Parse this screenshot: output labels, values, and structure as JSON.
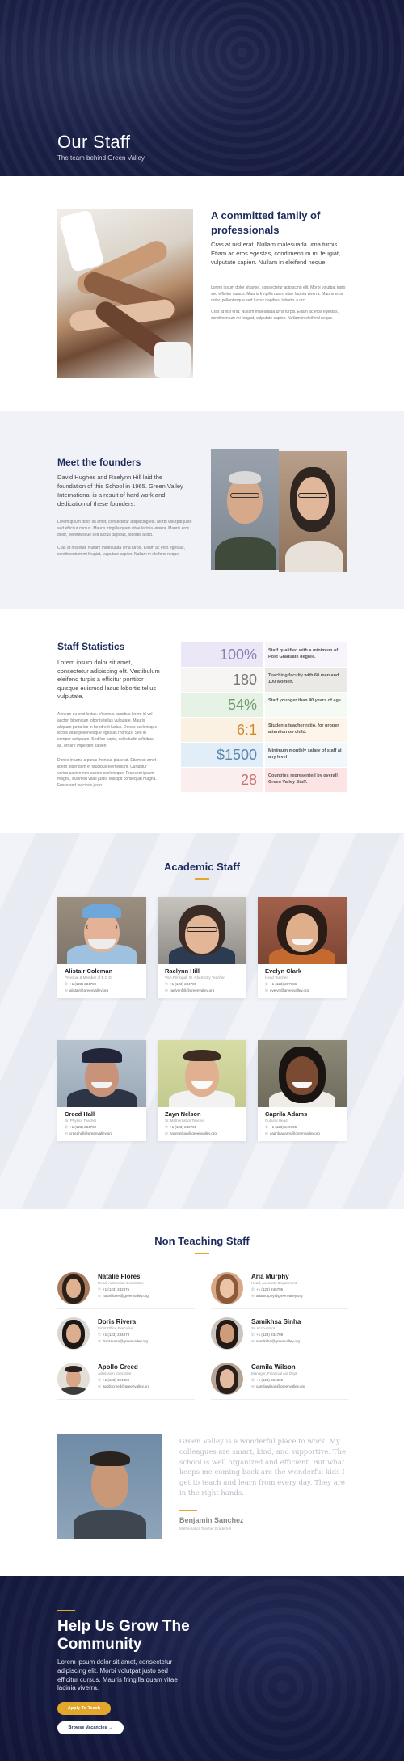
{
  "hero": {
    "title": "Our Staff",
    "subtitle": "The team behind Green Valley"
  },
  "committed": {
    "title": "A committed family of professionals",
    "lead": "Cras at nisl erat. Nullam malesuada urna turpis. Etiam ac eros egestas, condimentum mi feugiat, vulputate sapien. Nullam in eleifend neque.",
    "p1": "Lorem ipsum dolor sit amet, consectetur adipiscing elit. Morbi volutpat justo sed efficitur cursus. Mauris fringilla quam vitae lacinia viverra. Mauris eros dolor, pellentesque sed luctus dapibus, lobortis a orci.",
    "p2": "Cras at nisl erat. Nullam malesuada urna turpis. Etiam ac eros egestas, condimentum mi feugiat, vulputate sapien. Nullam in eleifend neque."
  },
  "founders": {
    "title": "Meet the founders",
    "lead": "David Hughes and Raelynn Hill laid the foundation of this School in 1965. Green Valley International is a result of hard work and dedication of these founders.",
    "p1": "Lorem ipsum dolor sit amet, consectetur adipiscing elit. Morbi volutpat justo sed efficitur cursus. Mauris fringilla quam vitae lacinia viverra. Mauris eros dolor, pellentesque sed luctus dapibus, lobortis a orci.",
    "p2": "Cras at nisl erat. Nullam malesuada urna turpis. Etiam ac eros egestas, condimentum mi feugiat, vulputate sapien. Nullam in eleifend neque."
  },
  "stats": {
    "title": "Staff Statistics",
    "lead": "Lorem ipsum dolor sit amet, consectetur adipiscing elit. Vestibulum eleifend turpis a efficitur porttitor quisque euismod lacus lobortis tellus vulputate.",
    "p1": "Aenean eu erat lectus. Vivamus faucibus lorem id vel auctor, bibendum lobortis tellus vulputate. Mauris aliquam porta leo in hendrerit luctus. Donec scelerisque lectus vitae pellentesque egestas rhoncus. Sed in semper est ipsum. Sed leo turpis, sollicitudin a finibus ac, ornare imperdiet sapien.",
    "p2": "Donec in urna a purus rhoncus placerat. Etiam sit amet libero bibendum et faucibus elementum. Curabitur varius sapien non sapien scelerisque. Praesent ipsum magna, euismod vitae justo, suscipit consequat magna. Fusce sed faucibus justo.",
    "rows": [
      {
        "value": "100%",
        "label": "Staff qualified with a minimum of Post Graduate degree.",
        "color": "#8a7fb4",
        "bg": "#ece7f6",
        "lbg": "#f7f5fb"
      },
      {
        "value": "180",
        "label": "Teaching faculty with 60 men and 100 women.",
        "color": "#777777",
        "bg": "#f1f0ee",
        "lbg": "#ebe9e6"
      },
      {
        "value": "54%",
        "label": "Staff younger than 40 years of age.",
        "color": "#6f9b6a",
        "bg": "#e6f2e5",
        "lbg": "#f6faf5"
      },
      {
        "value": "6:1",
        "label": "Students teacher ratio, for proper attention on child.",
        "color": "#cf8a2f",
        "bg": "#fbf1e2",
        "lbg": "#fdf5ea"
      },
      {
        "value": "$1500",
        "label": "Minimum monthly salary of staff at any level",
        "color": "#5b86ad",
        "bg": "#e1eef8",
        "lbg": "#f2f7fb"
      },
      {
        "value": "28",
        "label": "Countries represented by overall Green Valley Staff.",
        "color": "#cc6f6f",
        "bg": "#fbe9e9",
        "lbg": "#fcecec"
      }
    ]
  },
  "academic": {
    "title": "Academic Staff",
    "cards": [
      {
        "name": "Alistair Coleman",
        "role": "Principal & Member of B.O.D.",
        "phone": "+1 (123) 234789",
        "email": "alistair@greenvalley.org"
      },
      {
        "name": "Raelynn Hill",
        "role": "Vice Principal, Sr. Chemistry Teacher",
        "phone": "+1 (123) 234789",
        "email": "raelynnhill@greenvalley.org"
      },
      {
        "name": "Evelyn Clark",
        "role": "Head Teacher",
        "phone": "+1 (123) 287786",
        "email": "evelyn@greenvalley.org"
      },
      {
        "name": "Creed Hall",
        "role": "Sr. Physics Teacher",
        "phone": "+1 (123) 234789",
        "email": "creedhall@greenvalley.org"
      },
      {
        "name": "Zayn Nelson",
        "role": "Sr. Mathematics Teacher",
        "phone": "+1 (123) 246795",
        "email": "zaynnelson@greenvalley.org"
      },
      {
        "name": "Caprila Adams",
        "role": "Cultural Head",
        "phone": "+1 (123) 246795",
        "email": "caprilaadams@greenvalley.org"
      }
    ]
  },
  "nonteaching": {
    "title": "Non Teaching Staff",
    "people": [
      {
        "name": "Natalie Flores",
        "role": "Head, Admission Committee",
        "phone": "+1 (123) 242876",
        "email": "nataliflores@greenvalley.org"
      },
      {
        "name": "Aria Murphy",
        "role": "Head, Accounts Department",
        "phone": "+1 (123) 246795",
        "email": "ariamurphy@greenvalley.org"
      },
      {
        "name": "Doris Rivera",
        "role": "Front Office Executive",
        "phone": "+1 (123) 234879",
        "email": "dorisrivera@greenvalley.org"
      },
      {
        "name": "Samikhsa Sinha",
        "role": "Sr. Accountant",
        "phone": "+1 (123) 234789",
        "email": "samiksha@greenvalley.org"
      },
      {
        "name": "Apollo Creed",
        "role": "Admission Executive",
        "phone": "+1 (123) 324890",
        "email": "apollocreed@greenvalley.org"
      },
      {
        "name": "Camila Wilson",
        "role": "Manager, Financial Aid Dept.",
        "phone": "+1 (123) 234890",
        "email": "camilawilson@greenvalley.org"
      }
    ],
    "testimonial": {
      "quote": "Green Valley is a wonderful place to work. My colleagues are smart, kind, and supportive. The school is well organized and efficient. But what keeps me coming back are the wonderful kids I get to teach and learn from every day. They are in the right hands.",
      "name": "Benjamin Sanchez",
      "role": "Mathematics Teacher,Grade 5-8"
    }
  },
  "cta": {
    "title": "Help Us Grow The Community",
    "lead": "Lorem ipsum dolor sit amet, consectetur adipiscing elit. Morbi volutpat justo sed efficitur cursus. Mauris fringilla quam vitae lacinia viverra.",
    "apply_label": "Apply To Teach",
    "vacancies_label": "Browse Vacancies →"
  },
  "icons": {
    "phone": "phone-icon",
    "email": "email-icon"
  },
  "colors": {
    "navy": "#1d2b5c",
    "accent": "#e3a82b",
    "hero_bg": "#1c2148"
  }
}
